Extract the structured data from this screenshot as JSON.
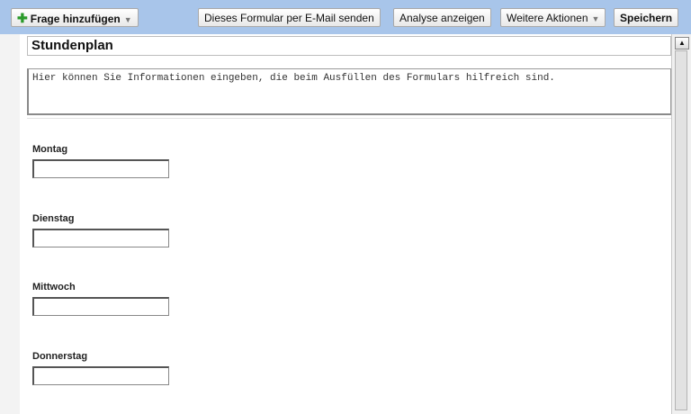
{
  "toolbar": {
    "add_question": "Frage hinzufügen",
    "send_email": "Dieses Formular per E-Mail senden",
    "show_analysis": "Analyse anzeigen",
    "more_actions": "Weitere Aktionen",
    "save": "Speichern"
  },
  "form": {
    "title": "Stundenplan",
    "description": "Hier können Sie Informationen eingeben, die beim Ausfüllen des Formulars hilfreich sind.",
    "questions": [
      {
        "label": "Montag"
      },
      {
        "label": "Dienstag"
      },
      {
        "label": "Mittwoch"
      },
      {
        "label": "Donnerstag"
      }
    ]
  }
}
